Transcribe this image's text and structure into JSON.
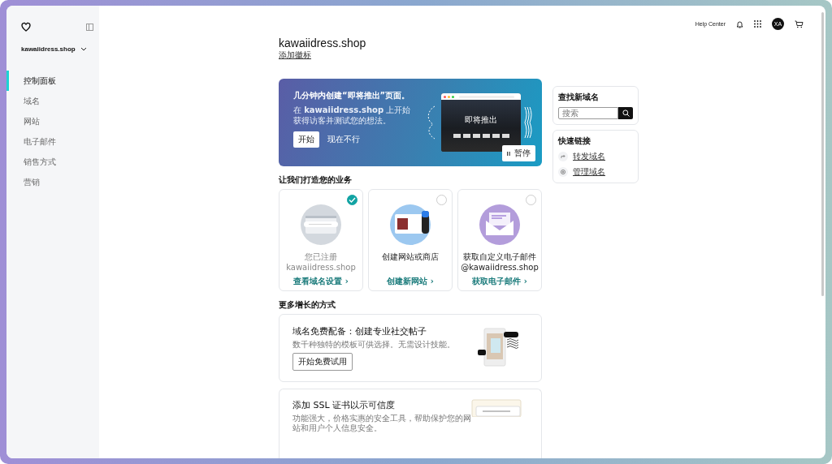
{
  "sidebar": {
    "domain": "kawaiidress.shop",
    "items": [
      {
        "label": "控制面板",
        "selected": true
      },
      {
        "label": "域名",
        "selected": false
      },
      {
        "label": "网站",
        "selected": false
      },
      {
        "label": "电子邮件",
        "selected": false
      },
      {
        "label": "销售方式",
        "selected": false
      },
      {
        "label": "营销",
        "selected": false
      }
    ]
  },
  "topbar": {
    "help": "Help Center",
    "avatar": "XA"
  },
  "header": {
    "title": "kawaiidress.shop",
    "link": "添加徽标"
  },
  "banner": {
    "title": "几分钟内创建“即将推出”页面。",
    "text": "在 **kawaiidress.shop** 上开始获得访客并测试您的想法。",
    "start": "开始",
    "later": "现在不行",
    "preview": "即将推出",
    "pause": "暂停"
  },
  "business": {
    "heading": "让我们打造您的业务",
    "cards": [
      {
        "kind": "domain",
        "text": "您已注册 kawaiidress.shop",
        "link": "查看域名设置 ›",
        "checked": true
      },
      {
        "kind": "website",
        "text": "创建网站或商店",
        "link": "创建新网站 ›",
        "checked": false
      },
      {
        "kind": "email",
        "text": "获取自定义电子邮件\n@kawaiidress.shop",
        "link": "获取电子邮件 ›",
        "checked": false
      }
    ]
  },
  "growth": {
    "heading": "更多增长的方式",
    "cards": [
      {
        "kind": "social",
        "title": "域名免费配备：创建专业社交帖子",
        "text": "数千种独特的模板可供选择。无需设计技能。",
        "button": "开始免费试用"
      },
      {
        "kind": "ssl",
        "title": "添加 SSL 证书以示可信度",
        "text": "功能强大，价格实惠的安全工具，帮助保护您的网站和用户个人信息安全。"
      }
    ]
  },
  "find_domain": {
    "title": "查找新域名",
    "placeholder": "搜索"
  },
  "quick_links": {
    "title": "快速链接",
    "links": [
      {
        "kind": "forward",
        "label": "转发域名"
      },
      {
        "kind": "manage",
        "label": "管理域名"
      }
    ]
  }
}
